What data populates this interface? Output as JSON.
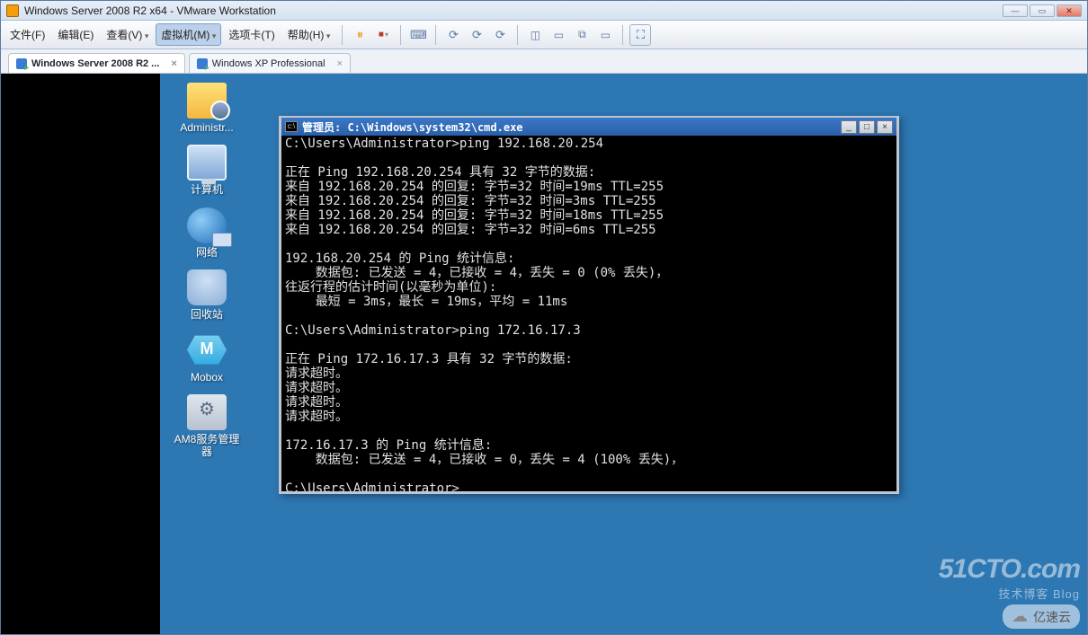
{
  "app": {
    "title": "Windows Server 2008 R2 x64 - VMware Workstation",
    "window_controls": {
      "min": "—",
      "max": "▭",
      "close": "✕"
    }
  },
  "menu": {
    "file": "文件(F)",
    "edit": "编辑(E)",
    "view": "查看(V)",
    "vm": "虚拟机(M)",
    "tabs": "选项卡(T)",
    "help": "帮助(H)"
  },
  "toolbar_icons": {
    "pause": "⏸",
    "stop": "■",
    "snapshot": "📷",
    "clock1": "⟳",
    "clock2": "⟳",
    "clock3": "⟳",
    "screen_split": "◫",
    "screen_one": "▭",
    "screen_multi": "⧉",
    "screen_wide": "▭",
    "full": "⛶"
  },
  "vm_tabs": [
    {
      "label": "Windows Server 2008 R2 ...",
      "active": true
    },
    {
      "label": "Windows XP Professional",
      "active": false
    }
  ],
  "desktop_icons": [
    {
      "key": "administrator",
      "label": "Administr...",
      "ico": "ico-folder"
    },
    {
      "key": "computer",
      "label": "计算机",
      "ico": "ico-computer"
    },
    {
      "key": "network",
      "label": "网络",
      "ico": "ico-network"
    },
    {
      "key": "recycle",
      "label": "回收站",
      "ico": "ico-recycle"
    },
    {
      "key": "mobox",
      "label": "Mobox",
      "ico": "ico-mobox"
    },
    {
      "key": "am8",
      "label": "AM8服务管理器",
      "ico": "ico-am8"
    }
  ],
  "cmd": {
    "title": "管理员: C:\\Windows\\system32\\cmd.exe",
    "btns": {
      "min": "_",
      "max": "□",
      "close": "×"
    },
    "lines": [
      "C:\\Users\\Administrator>ping 192.168.20.254",
      "",
      "正在 Ping 192.168.20.254 具有 32 字节的数据:",
      "来自 192.168.20.254 的回复: 字节=32 时间=19ms TTL=255",
      "来自 192.168.20.254 的回复: 字节=32 时间=3ms TTL=255",
      "来自 192.168.20.254 的回复: 字节=32 时间=18ms TTL=255",
      "来自 192.168.20.254 的回复: 字节=32 时间=6ms TTL=255",
      "",
      "192.168.20.254 的 Ping 统计信息:",
      "    数据包: 已发送 = 4，已接收 = 4，丢失 = 0 (0% 丢失)，",
      "往返行程的估计时间(以毫秒为单位):",
      "    最短 = 3ms，最长 = 19ms，平均 = 11ms",
      "",
      "C:\\Users\\Administrator>ping 172.16.17.3",
      "",
      "正在 Ping 172.16.17.3 具有 32 字节的数据:",
      "请求超时。",
      "请求超时。",
      "请求超时。",
      "请求超时。",
      "",
      "172.16.17.3 的 Ping 统计信息:",
      "    数据包: 已发送 = 4，已接收 = 0，丢失 = 4 (100% 丢失)，",
      "",
      "C:\\Users\\Administrator>"
    ]
  },
  "watermarks": {
    "cto_big": "51CTO.com",
    "cto_small": "技术博客  Blog",
    "yisu": "亿速云"
  }
}
